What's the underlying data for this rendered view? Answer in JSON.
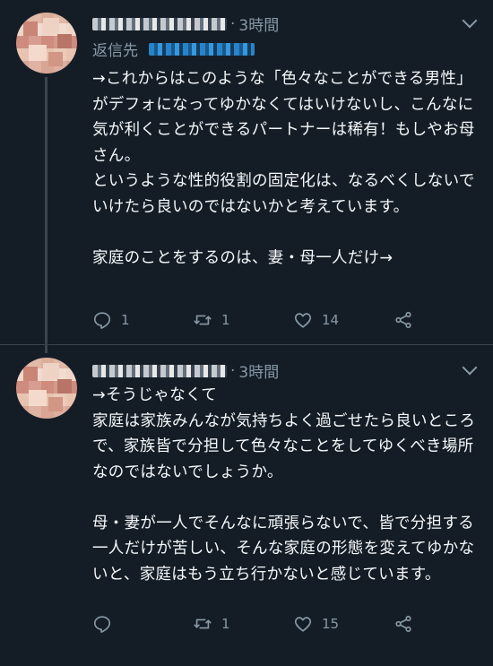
{
  "tweets": [
    {
      "name_obscured": "",
      "time": "3時間",
      "reply_label": "返信先",
      "text": "→これからはこのような「色々なことができる男性」がデフォになってゆかなくてはいけないし、こんなに気が利くことができるパートナーは稀有！もしやお母さん。\nというような性的役割の固定化は、なるべくしないでいけたら良いのではないかと考えています。\n\n家庭のことをするのは、妻・母一人だけ→",
      "actions": {
        "reply": "1",
        "retweet": "1",
        "like": "14"
      }
    },
    {
      "name_obscured": "",
      "time": "3時間",
      "text": "→そうじゃなくて\n家庭は家族みんなが気持ちよく過ごせたら良いところで、家族皆で分担して色々なことをしてゆくべき場所なのではないでしょうか。\n\n母・妻が一人でそんなに頑張らないで、皆で分担する一人だけが苦しい、そんな家庭の形態を変えてゆかないと、家庭はもう立ち行かないと感じています。",
      "actions": {
        "reply": "",
        "retweet": "1",
        "like": "15"
      }
    }
  ],
  "icons": [
    "reply-icon",
    "retweet-icon",
    "like-icon",
    "share-icon",
    "chevron-down-icon"
  ],
  "colors": {
    "background": "#141d26",
    "text": "#f5f8fa",
    "muted": "#8899a6",
    "link": "#1da1f2"
  }
}
